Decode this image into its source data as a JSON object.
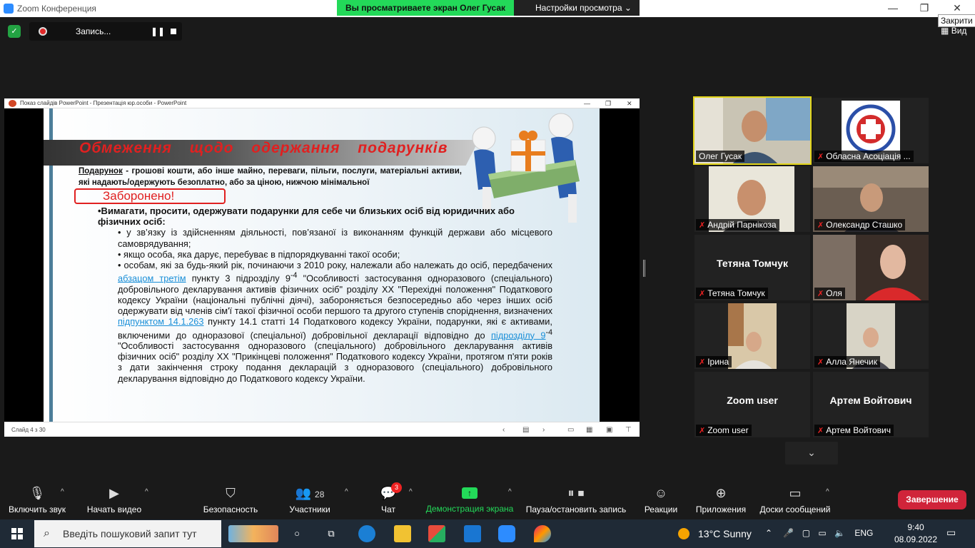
{
  "window": {
    "title": "Zoom Конференция",
    "share_banner": "Вы просматриваете экран Олег Гусак",
    "view_options": "Настройки просмотра",
    "close_tooltip": "Закрити",
    "view_label": "Вид",
    "recording_label": "Запись...",
    "colors": {
      "accent_green": "#23d959",
      "end_red": "#d0243a",
      "rec_red": "#e02828"
    }
  },
  "powerpoint": {
    "window_title": "Показ слайдів PowerPoint  -  Презентація юр.особи - PowerPoint",
    "status": "Слайд 4 з 30",
    "slide": {
      "title": "Обмеження щодо одержання подарунків",
      "definition_term": "Подарунок",
      "definition_rest": " - грошові кошти, або інше майно, переваги, пільги, послуги, матеріальні активи, які надають/одержують безоплатно, або за ціною, нижчою мінімальної",
      "forbidden": "Заборонено!",
      "heading": "•Вимагати, просити, одержувати подарунки для себе чи близьких осіб від юридичних або фізичних осіб:",
      "bullet1": "• у зв’язку із здійсненням  діяльності, пов’язаної із виконанням функцій держави або місцевого самоврядування;",
      "bullet2": "• якщо особа, яка дарує, перебуває в підпорядкуванні такої особи;",
      "bullet3_a": "• особам, які за будь-який рік, починаючи з 2010 року, належали або належать до осіб, передбачених ",
      "link1": "абзацом третім",
      "bullet3_b": " пункту 3 підрозділу 9",
      "sup1": "-4",
      "bullet3_c": " \"Особливості застосування одноразового (спеціального) добровільного декларування активів фізичних осіб\" розділу XX \"Перехідні положення\" Податкового кодексу України (національні публічні діячі), забороняється безпосередньо або через інших осіб одержувати від членів сім'ї такої фізичної особи першого та другого ступенів споріднення, визначених ",
      "link2": "підпунктом 14.1.263",
      "bullet3_d": " пункту 14.1 статті 14 Податкового кодексу України, подарунки, які є активами, включеними до одноразової (спеціальної) добровільної декларації відповідно до ",
      "link3": "підрозділу 9",
      "sup2": "-4",
      "bullet3_e": " \"Особливості застосування одноразового (спеціального) добровільного декларування активів фізичних осіб\" розділу XX \"Прикінцеві положення\" Податкового кодексу України, протягом п'яти років з дати закінчення строку подання декларацій з одноразового (спеціального) добровільного декларування відповідно до Податкового кодексу України."
    }
  },
  "participants": [
    {
      "name": "Олег Гусак",
      "muted": false,
      "active": true,
      "kind": "photo"
    },
    {
      "name": "Обласна Асоціація  ...",
      "muted": true,
      "active": false,
      "kind": "logo"
    },
    {
      "name": "Андрій Парнікоза",
      "muted": true,
      "active": false,
      "kind": "photo"
    },
    {
      "name": "Олександр Сташко",
      "muted": true,
      "active": false,
      "kind": "photo"
    },
    {
      "name": "Тетяна Томчук",
      "muted": true,
      "active": false,
      "kind": "text",
      "big": "Тетяна Томчук"
    },
    {
      "name": "Оля",
      "muted": true,
      "active": false,
      "kind": "photo"
    },
    {
      "name": "Ірина",
      "muted": true,
      "active": false,
      "kind": "photo"
    },
    {
      "name": "Алла Янечик",
      "muted": true,
      "active": false,
      "kind": "photo"
    },
    {
      "name": "Zoom user",
      "muted": true,
      "active": false,
      "kind": "text",
      "big": "Zoom user"
    },
    {
      "name": "Артем Войтович",
      "muted": true,
      "active": false,
      "kind": "text",
      "big": "Артем Войтович"
    }
  ],
  "toolbar": {
    "audio": "Включить звук",
    "video": "Начать видео",
    "security": "Безопасность",
    "participants": "Участники",
    "participants_count": "28",
    "chat": "Чат",
    "chat_badge": "3",
    "share": "Демонстрация экрана",
    "record": "Пауза/остановить запись",
    "reactions": "Реакции",
    "apps": "Приложения",
    "whiteboards": "Доски сообщений",
    "end": "Завершение"
  },
  "taskbar": {
    "search_placeholder": "Введіть пошуковий запит тут",
    "temperature": "13°C",
    "weather": "Sunny",
    "language": "ENG",
    "time": "9:40",
    "date": "08.09.2022"
  }
}
